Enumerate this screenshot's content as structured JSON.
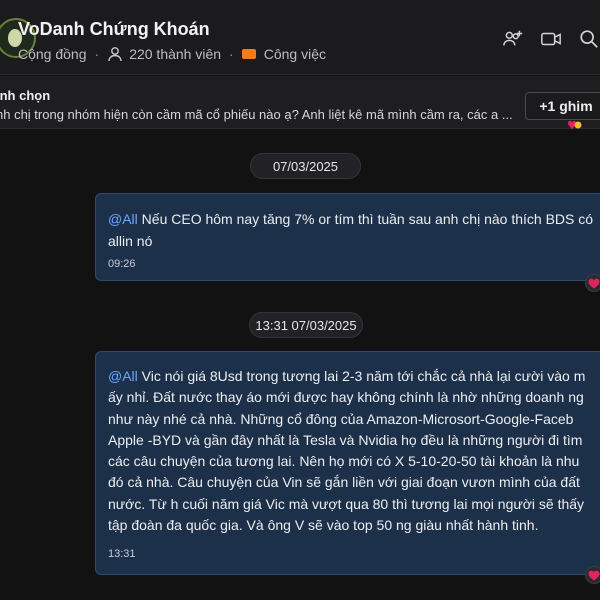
{
  "header": {
    "title": "VoDanh Chứng Khoán",
    "community_label": "Cộng đồng",
    "members_label": "220 thành viên",
    "work_label": "Công việc",
    "icons": [
      "add-people-icon",
      "video-call-icon",
      "search-icon"
    ]
  },
  "pinned": {
    "title": "ình chọn",
    "text": "nh chị trong nhóm hiện còn cầm mã cổ phiếu nào ạ? Anh liệt kê mã mình cầm ra, các a ...",
    "button_label": "+1 ghim"
  },
  "messages": [
    {
      "date_chip": "07/03/2025",
      "mention": "@All",
      "lines": [
        " Nếu CEO hôm nay tăng 7% or tím thì tuần sau anh chị nào thích BDS có",
        "allin nó"
      ],
      "time": "09:26",
      "reaction": "heart"
    },
    {
      "date_chip": "13:31 07/03/2025",
      "mention": "@All",
      "lines": [
        " Vic nói giá 8Usd trong tương lai 2-3 năm tới chắc cả nhà lại cười vào m",
        "ấy nhỉ. Đất nước thay áo mới được hay không chính là nhờ những doanh ng",
        "như này nhé cả nhà. Những cổ đông của Amazon-Microsort-Google-Faceb",
        "Apple -BYD và gần đây nhất là Tesla và Nvidia  họ đều là những người đi tìm",
        "các câu chuyện của tương lai. Nên họ mới có X 5-10-20-50 tài khoản là nhu",
        "đó cả nhà. Câu chuyện của Vin sẽ gắn liền với  giai đoạn vươn mình của đất",
        "nước.  Từ h cuối năm giá Vic mà vượt qua 80 thì tương lai mọi người sẽ thấy",
        "tập đoàn đa quốc gia. Và ông V sẽ vào top 50 ng giàu nhất hành tinh."
      ],
      "time": "13:31",
      "reaction": "heart"
    }
  ],
  "colors": {
    "background": "#121212",
    "bubble": "#1d3049",
    "mention": "#6aa8ff",
    "work_tag": "#f27c1c",
    "heart": "#e0245e"
  }
}
